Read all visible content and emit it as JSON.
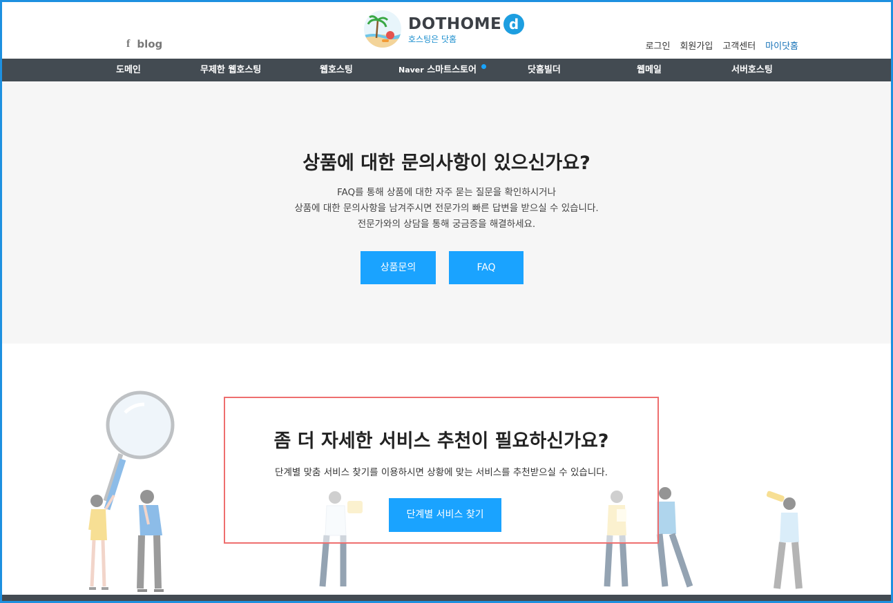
{
  "header": {
    "blog_label": "blog",
    "logo_title": "DOTHOME",
    "logo_d": "d",
    "logo_sub": "호스팅은 닷홈",
    "links": {
      "login": "로그인",
      "signup": "회원가입",
      "support": "고객센터",
      "mypage": "마이닷홈"
    }
  },
  "nav": {
    "domain": "도메인",
    "unlimited": "무제한 웹호스팅",
    "webhosting": "웹호스팅",
    "naver_prefix": "Naver",
    "naver_rest": " 스마트스토어",
    "builder": "닷홈빌더",
    "webmail": "웹메일",
    "server": "서버호스팅"
  },
  "inquiry": {
    "title": "상품에 대한 문의사항이 있으신가요?",
    "line1": "FAQ를 통해 상품에 대한 자주 묻는 질문을 확인하시거나",
    "line2": "상품에 대한 문의사항을 남겨주시면 전문가의 빠른 답변을 받으실 수 있습니다.",
    "line3": "전문가와의 상담을 통해 궁금증을 해결하세요.",
    "btn_inquiry": "상품문의",
    "btn_faq": "FAQ"
  },
  "recommend": {
    "title": "좀 더 자세한 서비스 추천이 필요하신가요?",
    "desc": "단계별 맞춤 서비스 찾기를 이용하시면 상황에 맞는 서비스를 추천받으실 수 있습니다.",
    "btn": "단계별 서비스 찾기"
  },
  "colors": {
    "accent": "#1aa3ff",
    "nav_bg": "#434b52",
    "highlight_border": "#ee6e6e",
    "frame": "#1e90e0"
  },
  "icons": [
    "facebook-icon",
    "logo-badge-icon",
    "notification-dot-icon"
  ]
}
